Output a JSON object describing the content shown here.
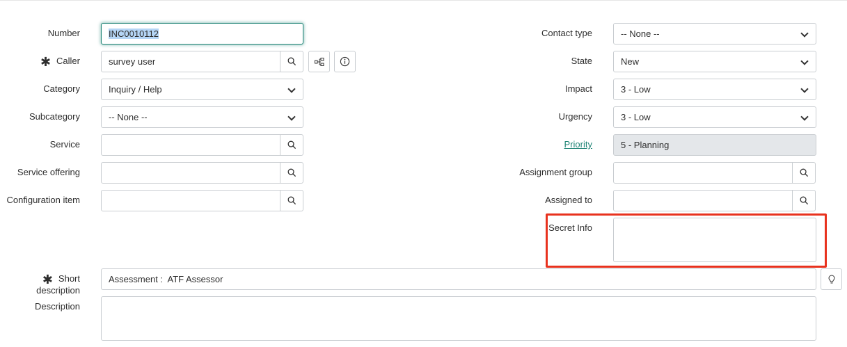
{
  "left": {
    "number": {
      "label": "Number",
      "value": "INC0010112"
    },
    "caller": {
      "label": "Caller",
      "value": "survey user"
    },
    "category": {
      "label": "Category",
      "value": "Inquiry / Help"
    },
    "subcategory": {
      "label": "Subcategory",
      "value": "-- None --"
    },
    "service": {
      "label": "Service",
      "value": ""
    },
    "service_offering": {
      "label": "Service offering",
      "value": ""
    },
    "configuration_item": {
      "label": "Configuration item",
      "value": ""
    }
  },
  "right": {
    "contact_type": {
      "label": "Contact type",
      "value": "-- None --"
    },
    "state": {
      "label": "State",
      "value": "New"
    },
    "impact": {
      "label": "Impact",
      "value": "3 - Low"
    },
    "urgency": {
      "label": "Urgency",
      "value": "3 - Low"
    },
    "priority": {
      "label": "Priority",
      "value": "5 - Planning"
    },
    "assignment_group": {
      "label": "Assignment group",
      "value": ""
    },
    "assigned_to": {
      "label": "Assigned to",
      "value": ""
    },
    "secret_info": {
      "label": "Secret Info",
      "value": ""
    }
  },
  "short_description": {
    "label": "Short description",
    "value": "Assessment :  ATF Assessor"
  },
  "description": {
    "label": "Description",
    "value": ""
  },
  "highlight_color": "#e8321e"
}
